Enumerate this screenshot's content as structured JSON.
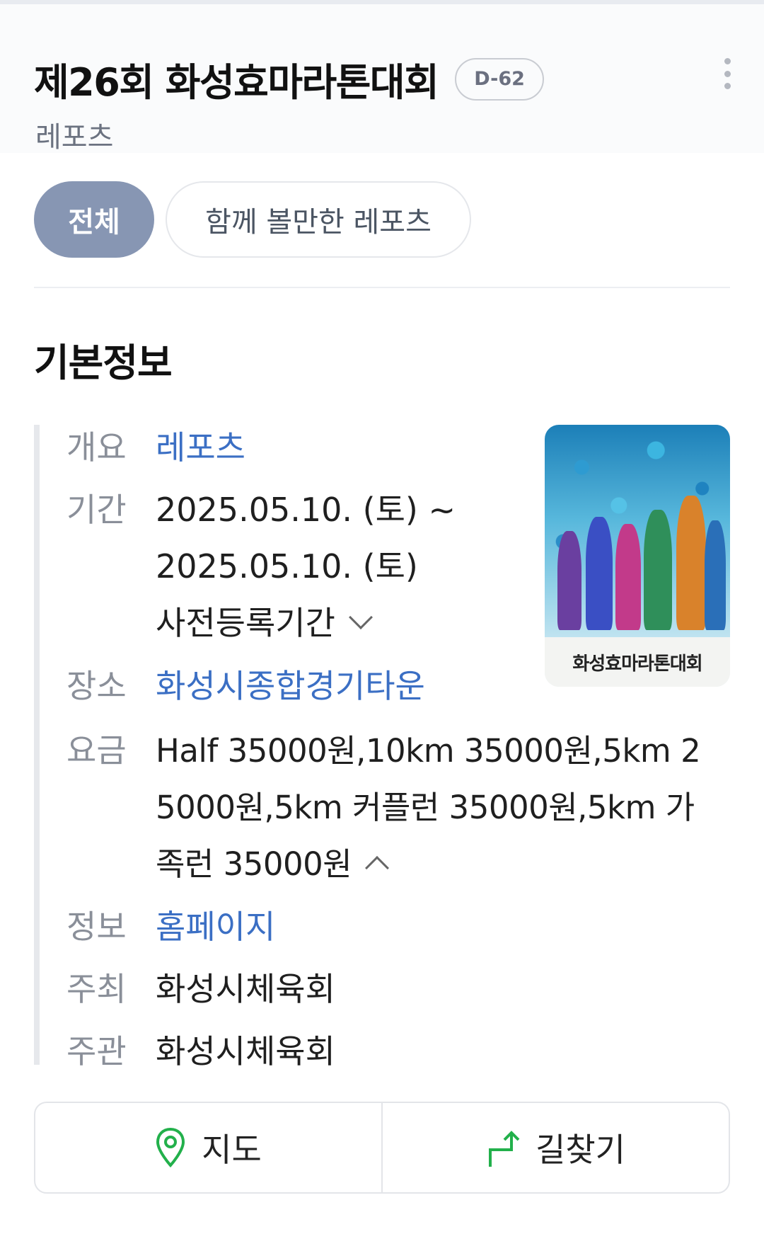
{
  "header": {
    "title": "제26회 화성효마라톤대회",
    "dday": "D-62",
    "subtitle": "레포츠"
  },
  "chips": {
    "all": "전체",
    "related": "함께 볼만한 레포츠"
  },
  "section": {
    "title": "기본정보"
  },
  "info": {
    "overview": {
      "label": "개요",
      "value": "레포츠"
    },
    "period": {
      "label": "기간",
      "line1": "2025.05.10. (토) ~",
      "line2": "2025.05.10. (토)",
      "pre_registration": "사전등록기간"
    },
    "place": {
      "label": "장소",
      "value": "화성시종합경기타운"
    },
    "fee": {
      "label": "요금",
      "line1": "Half 35000원,10km 35000원,5km 2",
      "line2": "5000원,5km 커플런 35000원,5km 가",
      "line3": "족런 35000원"
    },
    "homepage": {
      "label": "정보",
      "value": "홈페이지"
    },
    "host": {
      "label": "주최",
      "value": "화성시체육회"
    },
    "organizer": {
      "label": "주관",
      "value": "화성시체육회"
    }
  },
  "poster": {
    "caption": "화성효마라톤대회"
  },
  "actions": {
    "map": "지도",
    "directions": "길찾기"
  },
  "colors": {
    "link": "#3b6fc4",
    "chip_active": "#8796b3",
    "map_icon": "#22b04b",
    "directions_icon": "#22b04b"
  }
}
